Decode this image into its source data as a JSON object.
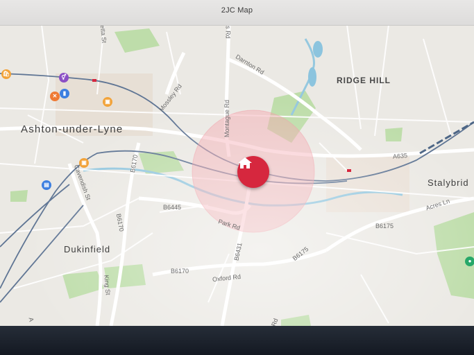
{
  "window": {
    "title": "2JC Map"
  },
  "colors": {
    "pin": "#d6273e",
    "radius_fill": "#f4a7ad",
    "park": "#b8dca0",
    "water": "#8fc6df",
    "rail": "#5a7190"
  },
  "map": {
    "places": {
      "ashton": "Ashton-under-Lyne",
      "ridge_hill": "RIDGE HILL",
      "dukinfield": "Dukinfield",
      "stalybridge": "Stalybrid"
    },
    "roads": {
      "darnton": "Darnton Rd",
      "mossley": "Mossley Rd",
      "montague": "Montague Rd",
      "b6170_a": "B6170",
      "b6170_b": "B6170",
      "b6170_c": "B6170",
      "cavendish": "Cavendish St",
      "b6445": "B6445",
      "park_rd": "Park Rd",
      "b6431": "B6431",
      "b6175_a": "B6175",
      "b6175_b": "B6175",
      "oxford": "Oxford Rd",
      "king": "King St",
      "a635": "A635",
      "acres": "Acres Ln",
      "etta": "etta St",
      "ns_rd": "n's Rd",
      "rd_bottom": "Rd",
      "a_side": "A"
    },
    "home_marker": {
      "icon": "home-icon"
    },
    "pois": [
      {
        "name": "restaurant-icon",
        "glyph": "🍴"
      },
      {
        "name": "shopping-icon",
        "glyph": "▣"
      }
    ]
  }
}
